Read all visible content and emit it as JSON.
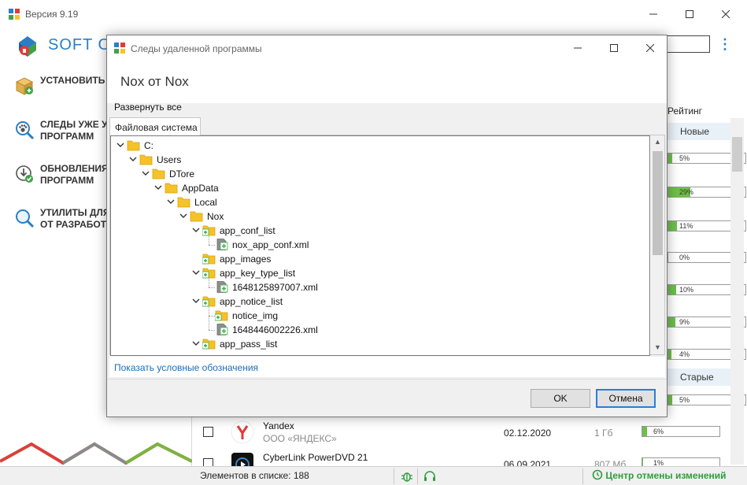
{
  "main_window": {
    "title": "Версия 9.19",
    "brand": "SOFT OR",
    "sidebar": {
      "items": [
        {
          "label_line1": "УСТАНОВИТЬ И",
          "label_line2": ""
        },
        {
          "label_line1": "СЛЕДЫ УЖЕ УД",
          "label_line2": "ПРОГРАММ"
        },
        {
          "label_line1": "ОБНОВЛЕНИЯ П",
          "label_line2": "ПРОГРАММ"
        },
        {
          "label_line1": "УТИЛИТЫ ДЛЯ",
          "label_line2": "ОТ РАЗРАБОТЧ"
        }
      ]
    },
    "content": {
      "rating_header": "Рейтинг",
      "group_new": "Новые",
      "group_old": "Старые",
      "ratings_new": [
        {
          "text": "5%",
          "value": 5
        },
        {
          "text": "29%",
          "value": 29
        },
        {
          "text": "11%",
          "value": 11
        },
        {
          "text": "0%",
          "value": 0
        },
        {
          "text": "10%",
          "value": 10
        },
        {
          "text": "9%",
          "value": 9
        },
        {
          "text": "4%",
          "value": 4
        }
      ],
      "ratings_old": [
        {
          "text": "5%",
          "value": 5
        }
      ],
      "rows": [
        {
          "name": "Yandex",
          "vendor": "ООО «ЯНДЕКС»",
          "date": "02.12.2020",
          "size": "1 Гб",
          "rating_text": "6%",
          "rating": 6
        },
        {
          "name": "CyberLink PowerDVD 21",
          "vendor": "",
          "date": "06.09.2021",
          "size": "807 Мб",
          "rating_text": "1%",
          "rating": 1
        }
      ]
    },
    "status": {
      "count_label": "Элементов в списке: 188",
      "undo_center": "Центр отмены изменений"
    }
  },
  "dialog": {
    "title": "Следы удаленной программы",
    "program_title": "Nox от Nox",
    "expand_all": "Развернуть все",
    "tab_label": "Файловая система",
    "legend_link": "Показать условные обозначения",
    "ok_label": "OK",
    "cancel_label": "Отмена",
    "tree": [
      {
        "label": "C:",
        "type": "folder",
        "level": 0,
        "expanded": true
      },
      {
        "label": "Users",
        "type": "folder",
        "level": 1,
        "expanded": true
      },
      {
        "label": "DTore",
        "type": "folder",
        "level": 2,
        "expanded": true
      },
      {
        "label": "AppData",
        "type": "folder",
        "level": 3,
        "expanded": true
      },
      {
        "label": "Local",
        "type": "folder",
        "level": 4,
        "expanded": true
      },
      {
        "label": "Nox",
        "type": "folder",
        "level": 5,
        "expanded": true
      },
      {
        "label": "app_conf_list",
        "type": "folder-added",
        "level": 6,
        "expanded": true
      },
      {
        "label": "nox_app_conf.xml",
        "type": "file-added",
        "level": 7,
        "expanded": false
      },
      {
        "label": "app_images",
        "type": "folder-added",
        "level": 6,
        "expanded": false
      },
      {
        "label": "app_key_type_list",
        "type": "folder-added",
        "level": 6,
        "expanded": true
      },
      {
        "label": "1648125897007.xml",
        "type": "file-added",
        "level": 7,
        "expanded": false
      },
      {
        "label": "app_notice_list",
        "type": "folder-added",
        "level": 6,
        "expanded": true
      },
      {
        "label": "notice_img",
        "type": "folder-added",
        "level": 7,
        "expanded": false
      },
      {
        "label": "1648446002226.xml",
        "type": "file-added",
        "level": 7,
        "expanded": false
      },
      {
        "label": "app_pass_list",
        "type": "folder-added",
        "level": 6,
        "expanded": true
      }
    ]
  },
  "colors": {
    "accent": "#2a7fc4",
    "folder": "#f5c227",
    "added": "#3cb043",
    "link": "#1a6fb5",
    "rating_fill": "#6cc04a",
    "undo_green": "#2e9d3a"
  }
}
